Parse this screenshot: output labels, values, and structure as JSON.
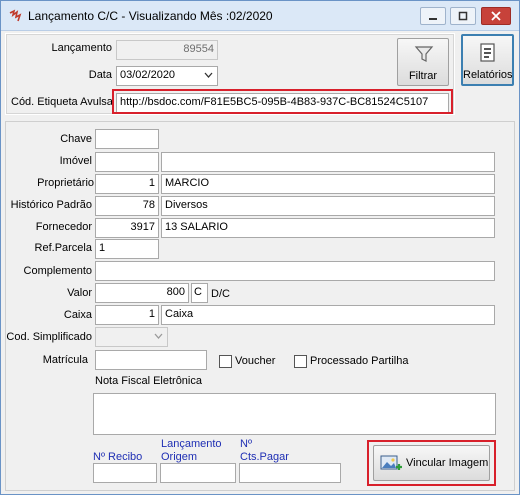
{
  "window": {
    "title": "Lançamento C/C - Visualizando Mês :02/2020"
  },
  "top": {
    "lancamento_label": "Lançamento",
    "lancamento_value": "89554",
    "data_label": "Data",
    "data_value": "03/02/2020",
    "etiqueta_label": "Cód. Etiqueta Avulsa",
    "etiqueta_value": "http://bsdoc.com/F81E5BC5-095B-4B83-937C-BC81524C5107",
    "filtrar_label": "Filtrar",
    "relatorios_label": "Relatórios"
  },
  "form": {
    "chave_label": "Chave",
    "imovel_label": "Imóvel",
    "proprietario_label": "Proprietário",
    "proprietario_code": "1",
    "proprietario_name": "MARCIO",
    "historico_label": "Histórico Padrão",
    "historico_code": "78",
    "historico_name": "Diversos",
    "fornecedor_label": "Fornecedor",
    "fornecedor_code": "3917",
    "fornecedor_name": "13 SALARIO",
    "refparcela_label": "Ref.Parcela",
    "refparcela_value": "1",
    "complemento_label": "Complemento",
    "valor_label": "Valor",
    "valor_value": "800",
    "dc_value": "C",
    "dc_label": "D/C",
    "caixa_label": "Caixa",
    "caixa_code": "1",
    "caixa_name": "Caixa",
    "codsimp_label": "Cod. Simplificado",
    "matricula_label": "Matrícula",
    "voucher_label": "Voucher",
    "processado_label": "Processado Partilha",
    "nfe_label": "Nota Fiscal Eletrônica",
    "nrecibo_label": "Nº Recibo",
    "lanc_origem_label_1": "Lançamento",
    "lanc_origem_label_2": "Origem",
    "ctspagar_label_1": "Nº",
    "ctspagar_label_2": "Cts.Pagar",
    "vincular_label": "Vincular Imagem"
  },
  "colors": {
    "highlight": "#d8202b",
    "blue_label": "#1f2fb4"
  }
}
